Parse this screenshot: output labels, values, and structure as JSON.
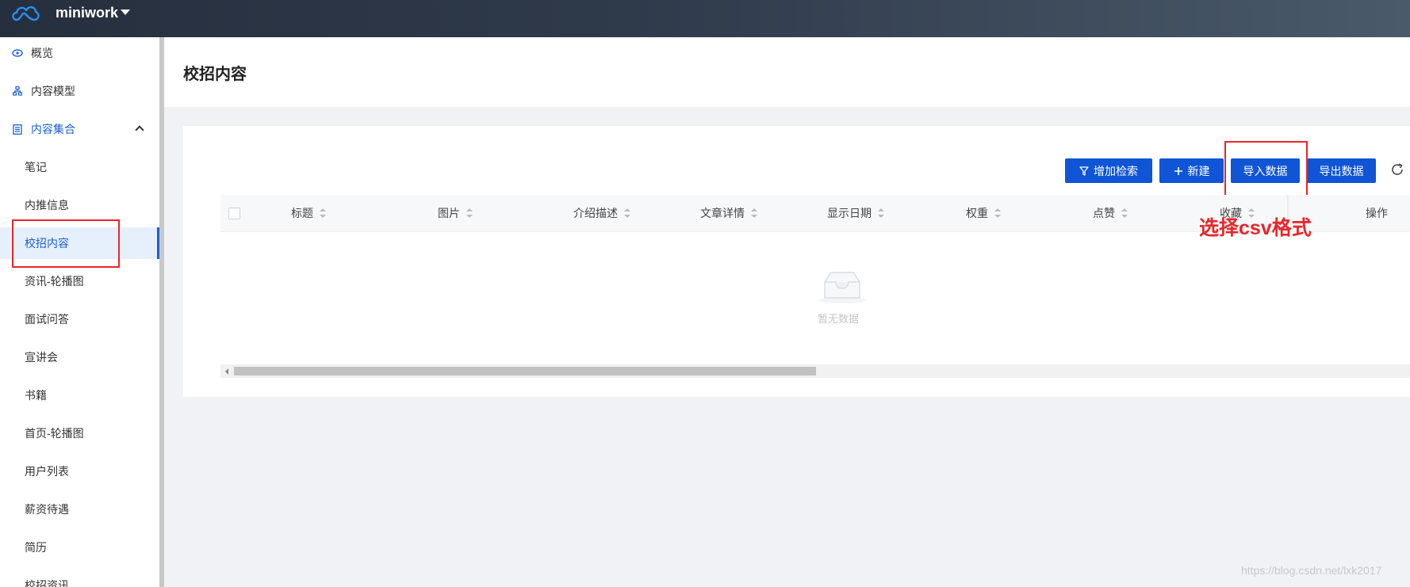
{
  "app": {
    "name": "miniwork",
    "logo_icon": "cloud-logo-icon"
  },
  "sidebar": {
    "items": [
      {
        "label": "概览",
        "icon": "eye-icon"
      },
      {
        "label": "内容模型",
        "icon": "sitemap-icon"
      },
      {
        "label": "内容集合",
        "icon": "collection-icon",
        "expanded": true
      }
    ],
    "sub_items": [
      {
        "label": "笔记"
      },
      {
        "label": "内推信息"
      },
      {
        "label": "校招内容",
        "active": true
      },
      {
        "label": "资讯-轮播图"
      },
      {
        "label": "面试问答"
      },
      {
        "label": "宣讲会"
      },
      {
        "label": "书籍"
      },
      {
        "label": "首页-轮播图"
      },
      {
        "label": "用户列表"
      },
      {
        "label": "薪资待遇"
      },
      {
        "label": "简历"
      },
      {
        "label": "校招资讯"
      }
    ]
  },
  "page": {
    "title": "校招内容"
  },
  "toolbar": {
    "filter_label": "增加检索",
    "new_label": "新建",
    "import_label": "导入数据",
    "export_label": "导出数据",
    "refresh_icon": "refresh-icon"
  },
  "table": {
    "columns": [
      "标题",
      "图片",
      "介绍描述",
      "文章详情",
      "显示日期",
      "权重",
      "点赞",
      "收藏",
      "操作"
    ],
    "empty_text": "暂无数据"
  },
  "annotation": {
    "text": "选择csv格式",
    "color": "#e8262a"
  },
  "watermark": "https://blog.csdn.net/lxk2017",
  "colors": {
    "primary": "#0f55d6",
    "active_bg": "#e6f0fc",
    "topbar": "#2f3a4b"
  }
}
